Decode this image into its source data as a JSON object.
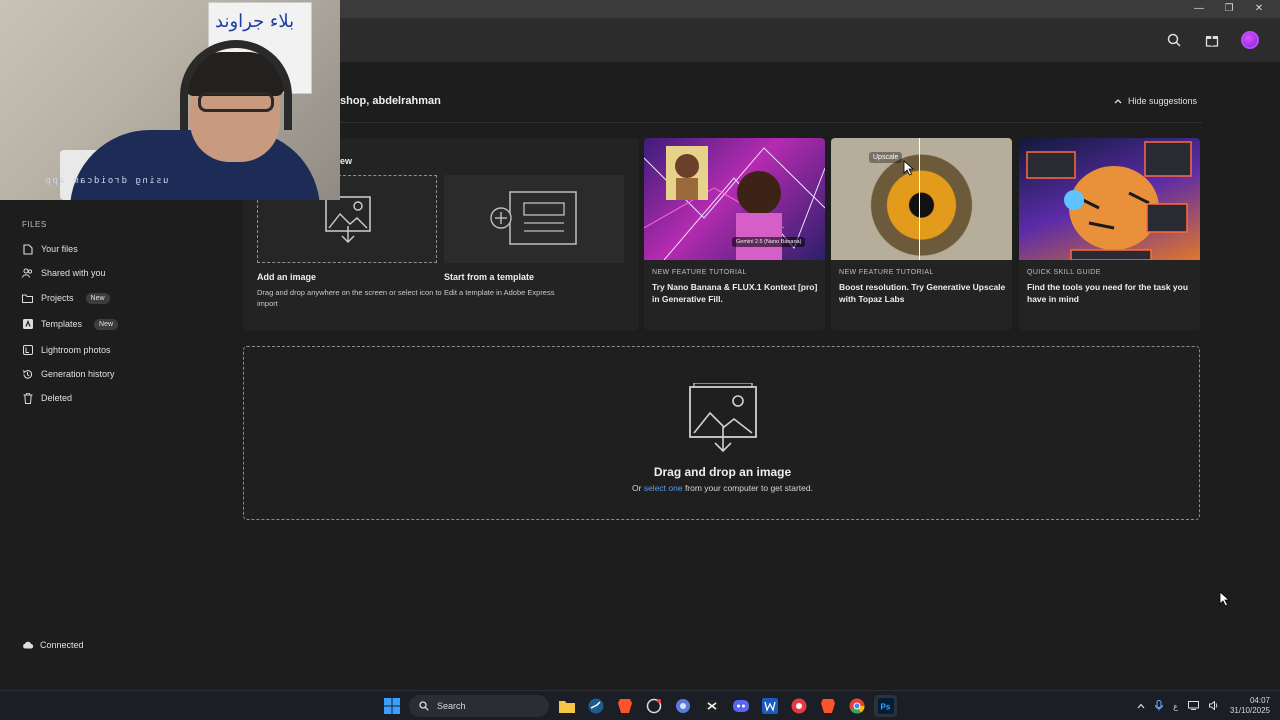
{
  "window": {
    "minimize": "—",
    "restore": "❐",
    "close": "✕"
  },
  "header": {
    "icons": [
      "search-icon",
      "gift-icon",
      "avatar"
    ]
  },
  "webcam": {
    "poster_text": "بلاء جراوند",
    "shirt_text": "using droidcam app"
  },
  "greeting": "shop, abdelrahman",
  "hide_suggestions": "Hide suggestions",
  "start": {
    "title": "ew",
    "add_image": {
      "label": "Add an image",
      "desc": "Drag and drop anywhere on the screen or select icon to import"
    },
    "template": {
      "label": "Start from a template",
      "desc": "Edit a template in Adobe Express"
    }
  },
  "suggestions": [
    {
      "kicker": "NEW FEATURE TUTORIAL",
      "title": "Try Nano Banana & FLUX.1 Kontext [pro] in Generative Fill.",
      "chip": "Gemini 2.5 (Nano Banana)"
    },
    {
      "kicker": "NEW FEATURE TUTORIAL",
      "title": "Boost resolution. Try Generative Upscale with Topaz Labs",
      "chip": "Upscale"
    },
    {
      "kicker": "QUICK SKILL GUIDE",
      "title": "Find the tools you need for the task you have in mind"
    }
  ],
  "sidebar": {
    "section": "FILES",
    "items": [
      {
        "label": "Your files",
        "icon": "file-icon"
      },
      {
        "label": "Shared with you",
        "icon": "people-icon"
      },
      {
        "label": "Projects",
        "icon": "folder-icon",
        "badge": "New"
      },
      {
        "label": "Templates",
        "icon": "templates-icon",
        "badge": "New"
      },
      {
        "label": "Lightroom photos",
        "icon": "lightroom-icon"
      },
      {
        "label": "Generation history",
        "icon": "history-icon"
      },
      {
        "label": "Deleted",
        "icon": "trash-icon"
      }
    ],
    "connected": "Connected"
  },
  "drop": {
    "title": "Drag and drop an image",
    "prefix": "Or ",
    "link": "select one",
    "suffix": " from your computer to get started."
  },
  "taskbar": {
    "search": "Search",
    "clock_time": "04:07",
    "clock_date": "31/10/2025",
    "lang": "ع"
  }
}
